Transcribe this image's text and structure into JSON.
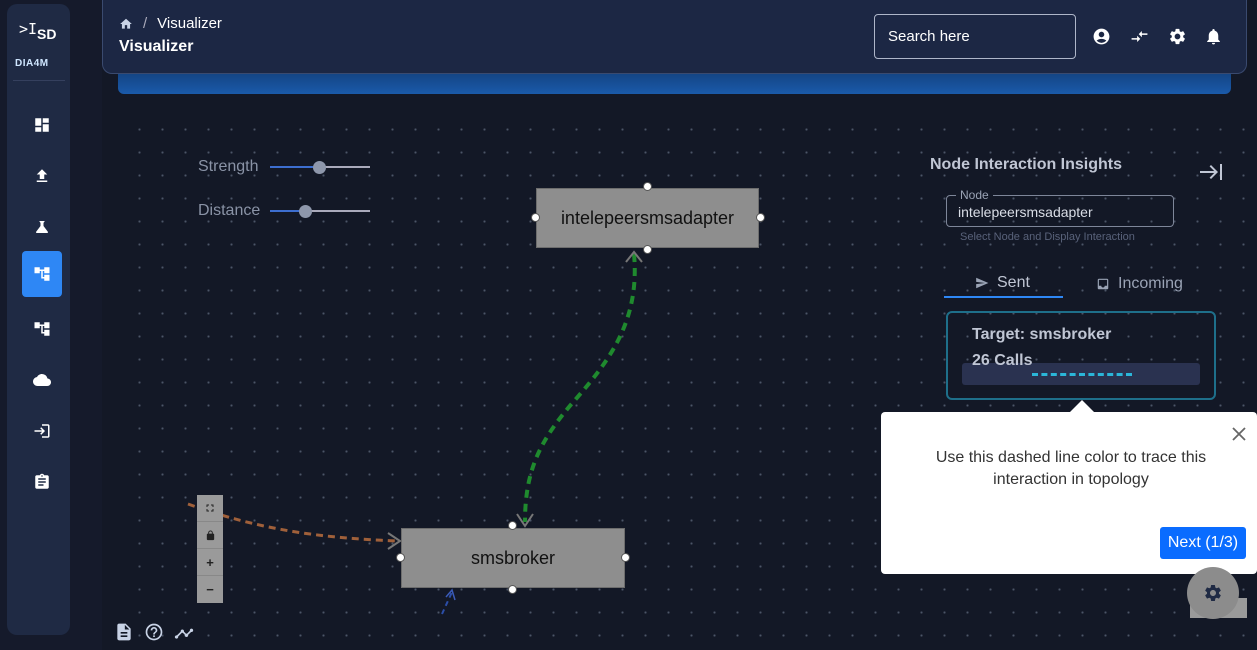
{
  "brand": {
    "collapse_glyph": ">I",
    "mark": "SD",
    "name": "DIA4M"
  },
  "sidebar": {
    "items": [
      {
        "name": "dashboard",
        "icon": "dashboard-icon"
      },
      {
        "name": "upload",
        "icon": "upload-icon"
      },
      {
        "name": "lab",
        "icon": "flask-icon"
      },
      {
        "name": "visualizer",
        "icon": "tree-icon",
        "active": true
      },
      {
        "name": "topology",
        "icon": "tree-icon"
      },
      {
        "name": "cloud",
        "icon": "cloud-icon"
      },
      {
        "name": "login",
        "icon": "login-icon"
      },
      {
        "name": "clipboard",
        "icon": "clipboard-icon"
      }
    ]
  },
  "header": {
    "breadcrumb": "Visualizer",
    "title": "Visualizer",
    "search_placeholder": "Search here"
  },
  "graph": {
    "strength_label": "Strength",
    "strength_value": 0.5,
    "distance_label": "Distance",
    "distance_value": 0.35,
    "nodes": [
      {
        "name": "intelepeersmsadapter"
      },
      {
        "name": "smsbroker"
      }
    ],
    "zoom_controls": [
      "fullscreen",
      "lock",
      "+",
      "−"
    ]
  },
  "panel": {
    "title": "Node Interaction Insights",
    "node_label": "Node",
    "node_value": "intelepeersmsadapter",
    "helper": "Select Node and Display Interaction",
    "tabs": [
      {
        "label": "Sent",
        "active": true
      },
      {
        "label": "Incoming",
        "active": false
      }
    ],
    "card": {
      "target": "Target: smsbroker",
      "calls": "26 Calls",
      "line_color": "#2bb6d9"
    }
  },
  "tour": {
    "message": "Use this dashed line color to trace this interaction in topology",
    "next_label": "Next (1/3)"
  },
  "colors": {
    "accent": "#2e87f5",
    "edge_sent": "#1f8a2e",
    "edge_incoming": "#a0603a"
  }
}
